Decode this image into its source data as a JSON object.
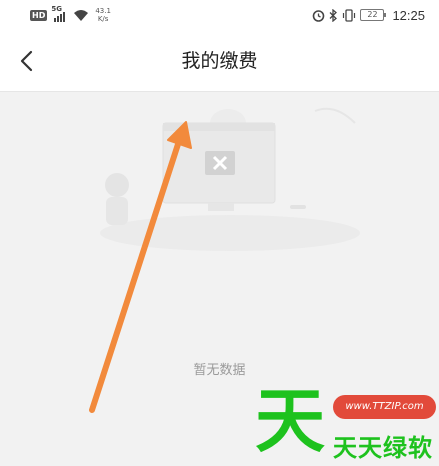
{
  "status_bar": {
    "hd": "HD",
    "network": "5G",
    "speed_value": "43.1",
    "speed_unit": "K/s",
    "battery": "22",
    "time": "12:25"
  },
  "header": {
    "title": "我的缴费"
  },
  "main": {
    "empty_text": "暂无数据"
  },
  "watermark": {
    "glyph": "天",
    "url": "www.TTZIP.com",
    "name": "天天绿软"
  },
  "colors": {
    "arrow": "#f28a3c",
    "watermark_green": "#1ec21e",
    "watermark_red": "#e24a3a"
  },
  "icons": [
    "wifi-icon",
    "alarm-icon",
    "bluetooth-icon",
    "vibrate-icon",
    "battery-icon",
    "back-arrow-icon",
    "close-x-icon"
  ]
}
